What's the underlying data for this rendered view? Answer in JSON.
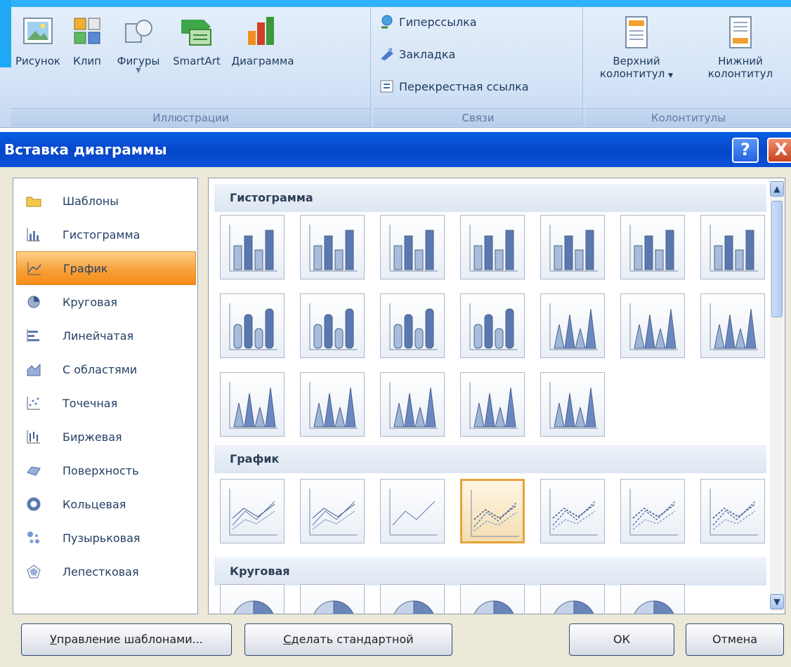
{
  "ribbon": {
    "illustrations": {
      "label": "Иллюстрации",
      "buttons": [
        {
          "label": "Рисунок",
          "icon": "picture-icon"
        },
        {
          "label": "Клип",
          "icon": "clip-art-icon"
        },
        {
          "label": "Фигуры",
          "icon": "shapes-icon"
        },
        {
          "label": "SmartArt",
          "icon": "smartart-icon"
        },
        {
          "label": "Диаграмма",
          "icon": "chart-icon"
        }
      ]
    },
    "links": {
      "label": "Связи",
      "items": [
        "Гиперссылка",
        "Закладка",
        "Перекрестная ссылка"
      ]
    },
    "header_footer": {
      "label": "Колонтитулы",
      "buttons": [
        {
          "line1": "Верхний",
          "line2": "колонтитул"
        },
        {
          "line1": "Нижний",
          "line2": "колонтитул"
        }
      ]
    }
  },
  "dialog": {
    "title": "Вставка диаграммы",
    "help": "?",
    "close": "X",
    "categories": [
      {
        "label": "Шаблоны",
        "icon": "folder-icon"
      },
      {
        "label": "Гистограмма",
        "icon": "column-chart-icon"
      },
      {
        "label": "График",
        "icon": "line-chart-icon",
        "selected": true
      },
      {
        "label": "Круговая",
        "icon": "pie-chart-icon"
      },
      {
        "label": "Линейчатая",
        "icon": "bar-chart-icon"
      },
      {
        "label": "С областями",
        "icon": "area-chart-icon"
      },
      {
        "label": "Точечная",
        "icon": "scatter-chart-icon"
      },
      {
        "label": "Биржевая",
        "icon": "stock-chart-icon"
      },
      {
        "label": "Поверхность",
        "icon": "surface-chart-icon"
      },
      {
        "label": "Кольцевая",
        "icon": "doughnut-chart-icon"
      },
      {
        "label": "Пузырьковая",
        "icon": "bubble-chart-icon"
      },
      {
        "label": "Лепестковая",
        "icon": "radar-chart-icon"
      }
    ],
    "sections": [
      {
        "title": "Гистограмма",
        "tile_count": 19
      },
      {
        "title": "График",
        "tile_count": 7,
        "selected_index": 3
      },
      {
        "title": "Круговая",
        "tile_count": 6
      }
    ],
    "buttons": {
      "manage_templates": {
        "underline": "У",
        "rest": "правление шаблонами..."
      },
      "set_default": {
        "underline": "С",
        "rest": "делать стандартной"
      },
      "ok": "ОК",
      "cancel": "Отмена"
    }
  }
}
